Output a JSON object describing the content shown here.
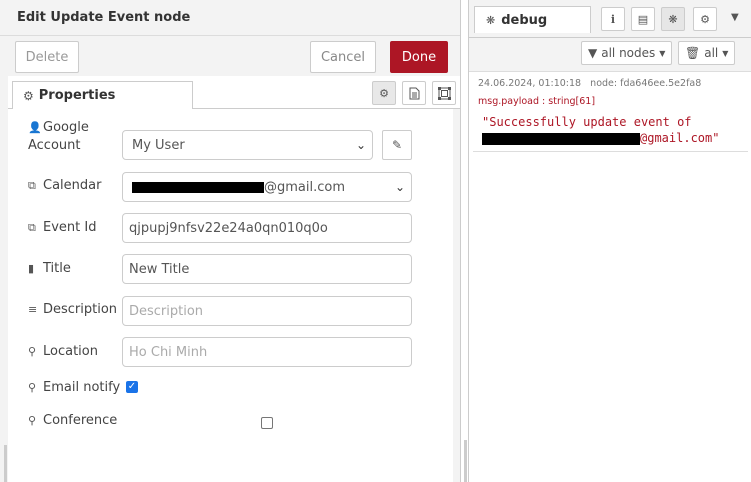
{
  "tray": {
    "title": "Edit Update Event node",
    "delete_label": "Delete",
    "cancel_label": "Cancel",
    "done_label": "Done",
    "tab_properties": "Properties"
  },
  "form": {
    "google_account": {
      "label_line1": "Google",
      "label_line2": "Account",
      "value": "My User"
    },
    "calendar": {
      "label": "Calendar",
      "value_suffix": "@gmail.com"
    },
    "event_id": {
      "label": "Event Id",
      "value": "qjpupj9nfsv22e24a0qn010q0o"
    },
    "title": {
      "label": "Title",
      "value": "New Title"
    },
    "description": {
      "label": "Description",
      "placeholder": "Description"
    },
    "location": {
      "label": "Location",
      "placeholder": "Ho Chi Minh"
    },
    "email_notify": {
      "label": "Email notify",
      "checked": true
    },
    "conference": {
      "label": "Conference",
      "checked": false
    }
  },
  "sidebar": {
    "tab_label": "debug",
    "filter_nodes_label": "all nodes",
    "clear_label": "all",
    "message": {
      "timestamp": "24.06.2024, 01:10:18",
      "node": "node: fda646ee.5e2fa8",
      "topic": "msg.payload : string[61]",
      "payload_line1": "\"Successfully update event of",
      "payload_line2_suffix": "@gmail.com\""
    }
  },
  "colors": {
    "done_button": "#ad1625",
    "payload_text": "#ad1625",
    "checkbox_checked": "#1a73e8"
  }
}
